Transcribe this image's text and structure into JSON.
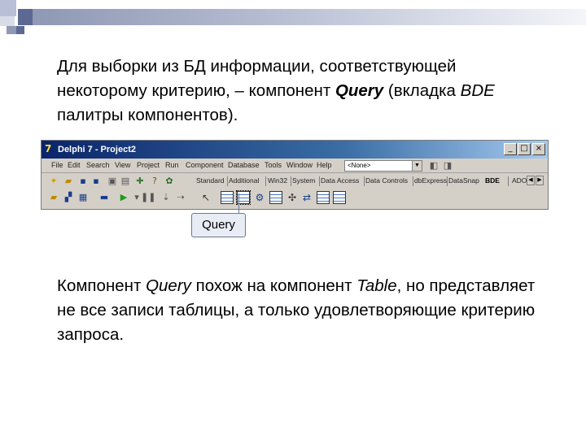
{
  "slide": {
    "paragraph1": {
      "part1": "Для выборки из БД информации, соответствующей некоторому критерию, – компонент ",
      "query_term": "Query",
      "part2": " (вкладка ",
      "bde_term": "BDE",
      "part3": " палитры компонентов)."
    },
    "paragraph2": {
      "part1": "Компонент ",
      "query_term": "Query",
      "part2": " похож на компонент ",
      "table_term": "Table",
      "part3": ", но представляет не все записи таблицы, а только удовлетворяющие критерию запроса."
    },
    "callout_label": "Query"
  },
  "ide_window": {
    "title": "Delphi 7 - Project2",
    "window_buttons": [
      "_",
      "□",
      "×"
    ],
    "menu": [
      "File",
      "Edit",
      "Search",
      "View",
      "Project",
      "Run",
      "Component",
      "Database",
      "Tools",
      "Window",
      "Help"
    ],
    "combo_value": "<None>",
    "palette_tabs": [
      "Standard",
      "Additional",
      "Win32",
      "System",
      "Data Access",
      "Data Controls",
      "dbExpress",
      "DataSnap",
      "BDE",
      "ADO"
    ],
    "active_tab": "BDE"
  },
  "colors": {
    "title_bar": "#0a246a",
    "callout_border": "#6a7898",
    "deco_dark": "#5c6a93"
  }
}
